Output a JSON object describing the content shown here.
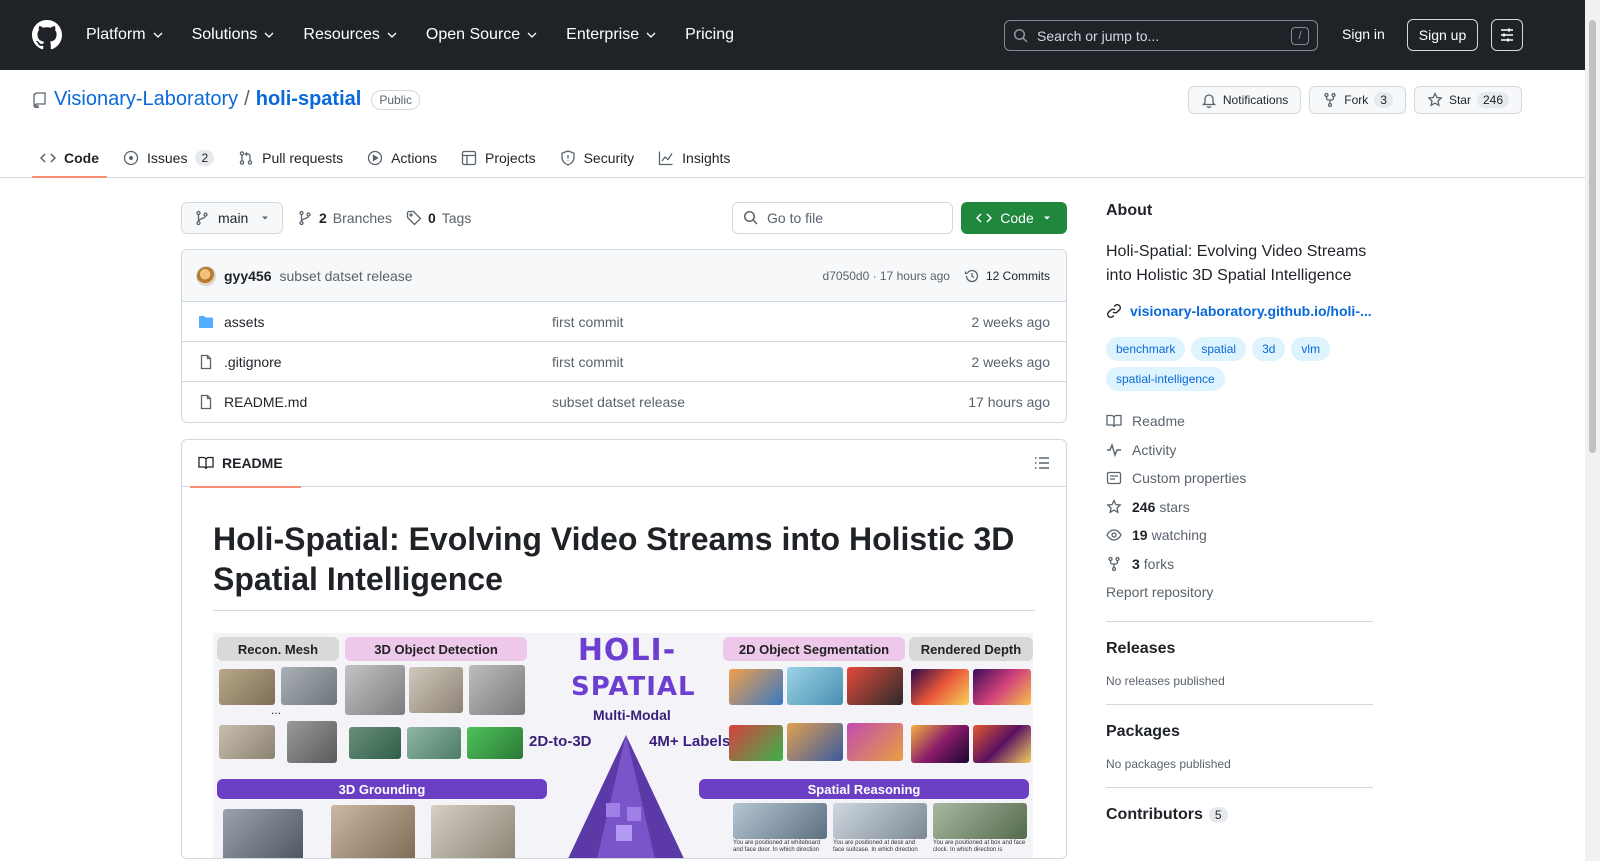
{
  "header": {
    "nav": [
      "Platform",
      "Solutions",
      "Resources",
      "Open Source",
      "Enterprise",
      "Pricing"
    ],
    "search_placeholder": "Search or jump to...",
    "search_shortcut": "/",
    "signin": "Sign in",
    "signup": "Sign up"
  },
  "repo": {
    "owner": "Visionary-Laboratory",
    "sep": "/",
    "name": "holi-spatial",
    "visibility": "Public",
    "notifications": "Notifications",
    "fork_label": "Fork",
    "fork_count": "3",
    "star_label": "Star",
    "star_count": "246",
    "tabs": [
      {
        "label": "Code"
      },
      {
        "label": "Issues",
        "count": "2"
      },
      {
        "label": "Pull requests"
      },
      {
        "label": "Actions"
      },
      {
        "label": "Projects"
      },
      {
        "label": "Security"
      },
      {
        "label": "Insights"
      }
    ]
  },
  "toolbar": {
    "branch": "main",
    "branches_count": "2",
    "branches_label": "Branches",
    "tags_count": "0",
    "tags_label": "Tags",
    "goto_placeholder": "Go to file",
    "code_btn": "Code"
  },
  "commit": {
    "author": "gyy456",
    "message": "subset datset release",
    "meta": "d7050d0 · 17 hours ago",
    "commits": "12 Commits"
  },
  "files": [
    {
      "name": "assets",
      "type": "folder",
      "commit": "first commit",
      "age": "2 weeks ago"
    },
    {
      "name": ".gitignore",
      "type": "file",
      "commit": "first commit",
      "age": "2 weeks ago"
    },
    {
      "name": "README.md",
      "type": "file",
      "commit": "subset datset release",
      "age": "17 hours ago"
    }
  ],
  "readme": {
    "tab": "README",
    "title": "Holi-Spatial: Evolving Video Streams into Holistic 3D Spatial Intelligence",
    "banner": {
      "labels": [
        "Recon. Mesh",
        "3D Object Detection",
        "2D Object Segmentation",
        "Rendered Depth",
        "3D Grounding",
        "Spatial Reasoning"
      ],
      "logo_line1": "HOLI-",
      "logo_line2": "SPATIAL",
      "multimodal": "Multi-Modal",
      "left_tag": "2D-to-3D",
      "right_tag": "4M+ Labels",
      "dots": "...",
      "captions": [
        "You are positioned at whiteboard and face door. In which direction",
        "You are positioned at desk and face suitcase. In which direction",
        "You are positioned at box and face clock. In which direction is"
      ]
    }
  },
  "about": {
    "heading": "About",
    "description": "Holi-Spatial: Evolving Video Streams into Holistic 3D Spatial Intelligence",
    "link": "visionary-laboratory.github.io/holi-...",
    "topics": [
      "benchmark",
      "spatial",
      "3d",
      "vlm",
      "spatial-intelligence"
    ],
    "readme": "Readme",
    "activity": "Activity",
    "custom_properties": "Custom properties",
    "stars_count": "246",
    "stars_label": "stars",
    "watching_count": "19",
    "watching_label": "watching",
    "forks_count": "3",
    "forks_label": "forks",
    "report": "Report repository"
  },
  "releases": {
    "heading": "Releases",
    "empty": "No releases published"
  },
  "packages": {
    "heading": "Packages",
    "empty": "No packages published"
  },
  "contributors": {
    "heading": "Contributors",
    "count": "5"
  }
}
